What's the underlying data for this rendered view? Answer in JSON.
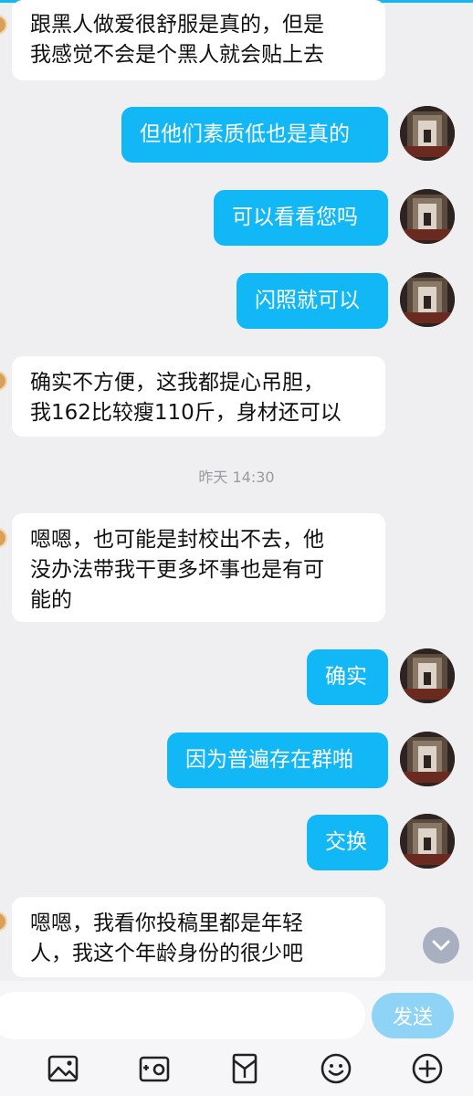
{
  "messages": [
    {
      "side": "in",
      "text": "跟黑人做爱很舒服是真的，但是\n我感觉不会是个黑人就会贴上去"
    },
    {
      "side": "out",
      "text": "但他们素质低也是真的"
    },
    {
      "side": "out",
      "text": "可以看看您吗"
    },
    {
      "side": "out",
      "text": "闪照就可以"
    },
    {
      "side": "in",
      "text": "确实不方便，这我都提心吊胆，\n我162比较瘦110斤，身材还可以"
    },
    {
      "side": "in",
      "text": "嗯嗯，也可能是封校出不去，他\n没办法带我干更多坏事也是有可\n能的"
    },
    {
      "side": "out",
      "text": "确实"
    },
    {
      "side": "out",
      "text": "因为普遍存在群啪"
    },
    {
      "side": "out",
      "text": "交换"
    },
    {
      "side": "in",
      "text": "嗯嗯，我看你投稿里都是年轻\n人，我这个年龄身份的很少吧"
    }
  ],
  "timestamp": "昨天 14:30",
  "input": {
    "value": "",
    "send_label": "发送"
  },
  "toolbar": [
    "image-icon",
    "camera-icon",
    "red-packet-icon",
    "emoji-icon",
    "plus-icon"
  ],
  "colors": {
    "accent": "#12b7f5",
    "send_disabled": "#8fd3f6",
    "background": "#efeff1"
  }
}
